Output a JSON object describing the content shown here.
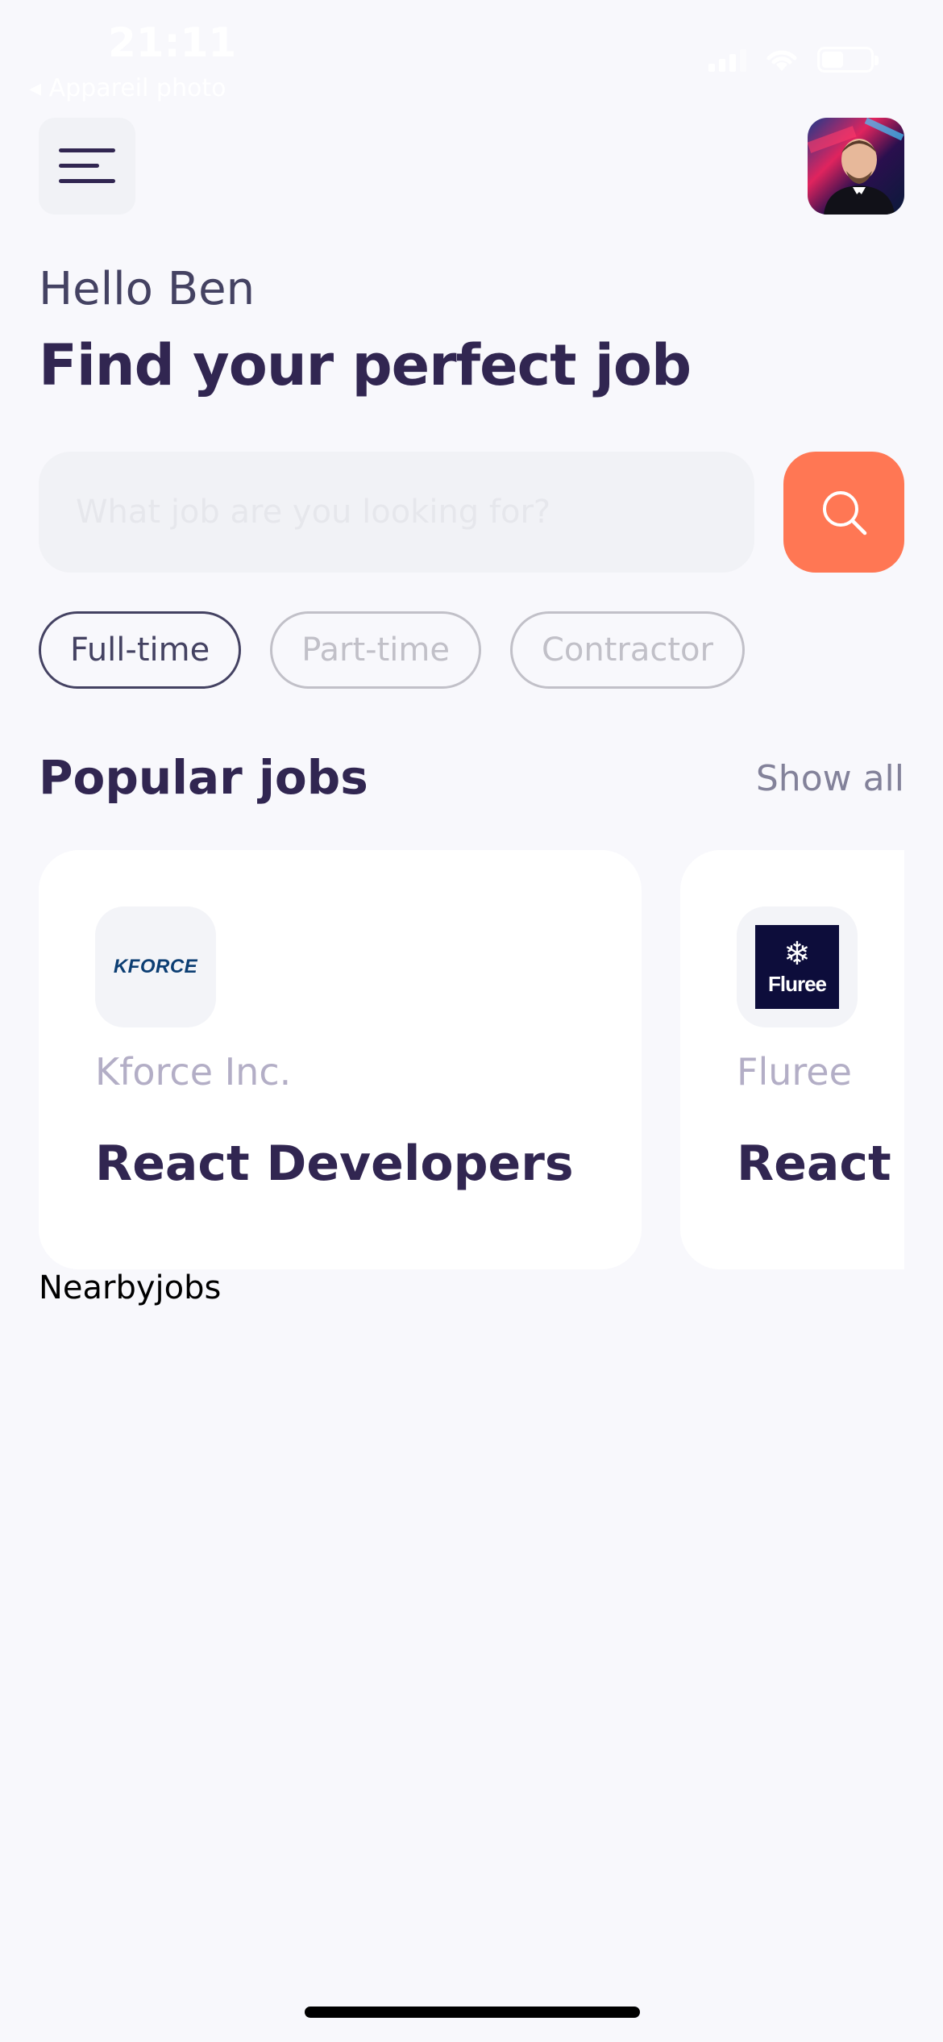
{
  "status_bar": {
    "time": "21:11",
    "back_label": "◂ Appareil photo"
  },
  "header": {
    "menu_icon": "menu-lines-icon",
    "avatar_alt": "profile-photo"
  },
  "welcome": {
    "greeting": "Hello Ben",
    "headline": "Find your perfect job"
  },
  "search": {
    "placeholder": "What job are you looking for?",
    "value": "",
    "button_icon": "search-icon"
  },
  "job_types": [
    {
      "label": "Full-time",
      "active": true
    },
    {
      "label": "Part-time",
      "active": false
    },
    {
      "label": "Contractor",
      "active": false
    }
  ],
  "popular": {
    "title": "Popular jobs",
    "show_all": "Show all",
    "cards": [
      {
        "company": "Kforce Inc.",
        "job_title": "React Developers",
        "logo_text": "KFORCE"
      },
      {
        "company": "Fluree",
        "job_title": "React Developers",
        "logo_text": "Fluree"
      }
    ]
  },
  "nearby": {
    "title": "Nearbyjobs"
  },
  "colors": {
    "primary": "#312651",
    "accent": "#FF7754",
    "gray": "#83829A",
    "light_white": "#F8F8FC"
  }
}
